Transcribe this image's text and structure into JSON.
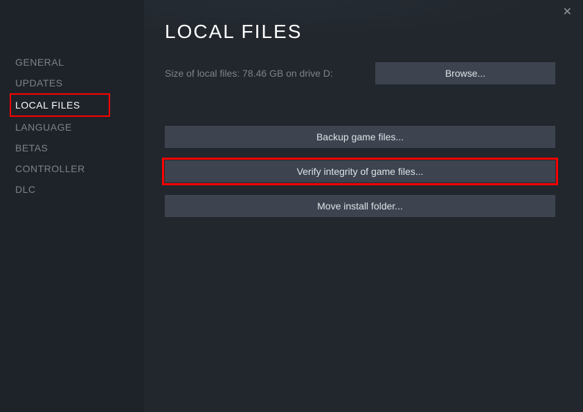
{
  "sidebar": {
    "items": [
      {
        "label": "GENERAL",
        "active": false
      },
      {
        "label": "UPDATES",
        "active": false
      },
      {
        "label": "LOCAL FILES",
        "active": true
      },
      {
        "label": "LANGUAGE",
        "active": false
      },
      {
        "label": "BETAS",
        "active": false
      },
      {
        "label": "CONTROLLER",
        "active": false
      },
      {
        "label": "DLC",
        "active": false
      }
    ]
  },
  "main": {
    "title": "LOCAL FILES",
    "size_text": "Size of local files: 78.46 GB on drive D:",
    "browse_label": "Browse...",
    "backup_label": "Backup game files...",
    "verify_label": "Verify integrity of game files...",
    "move_label": "Move install folder..."
  }
}
